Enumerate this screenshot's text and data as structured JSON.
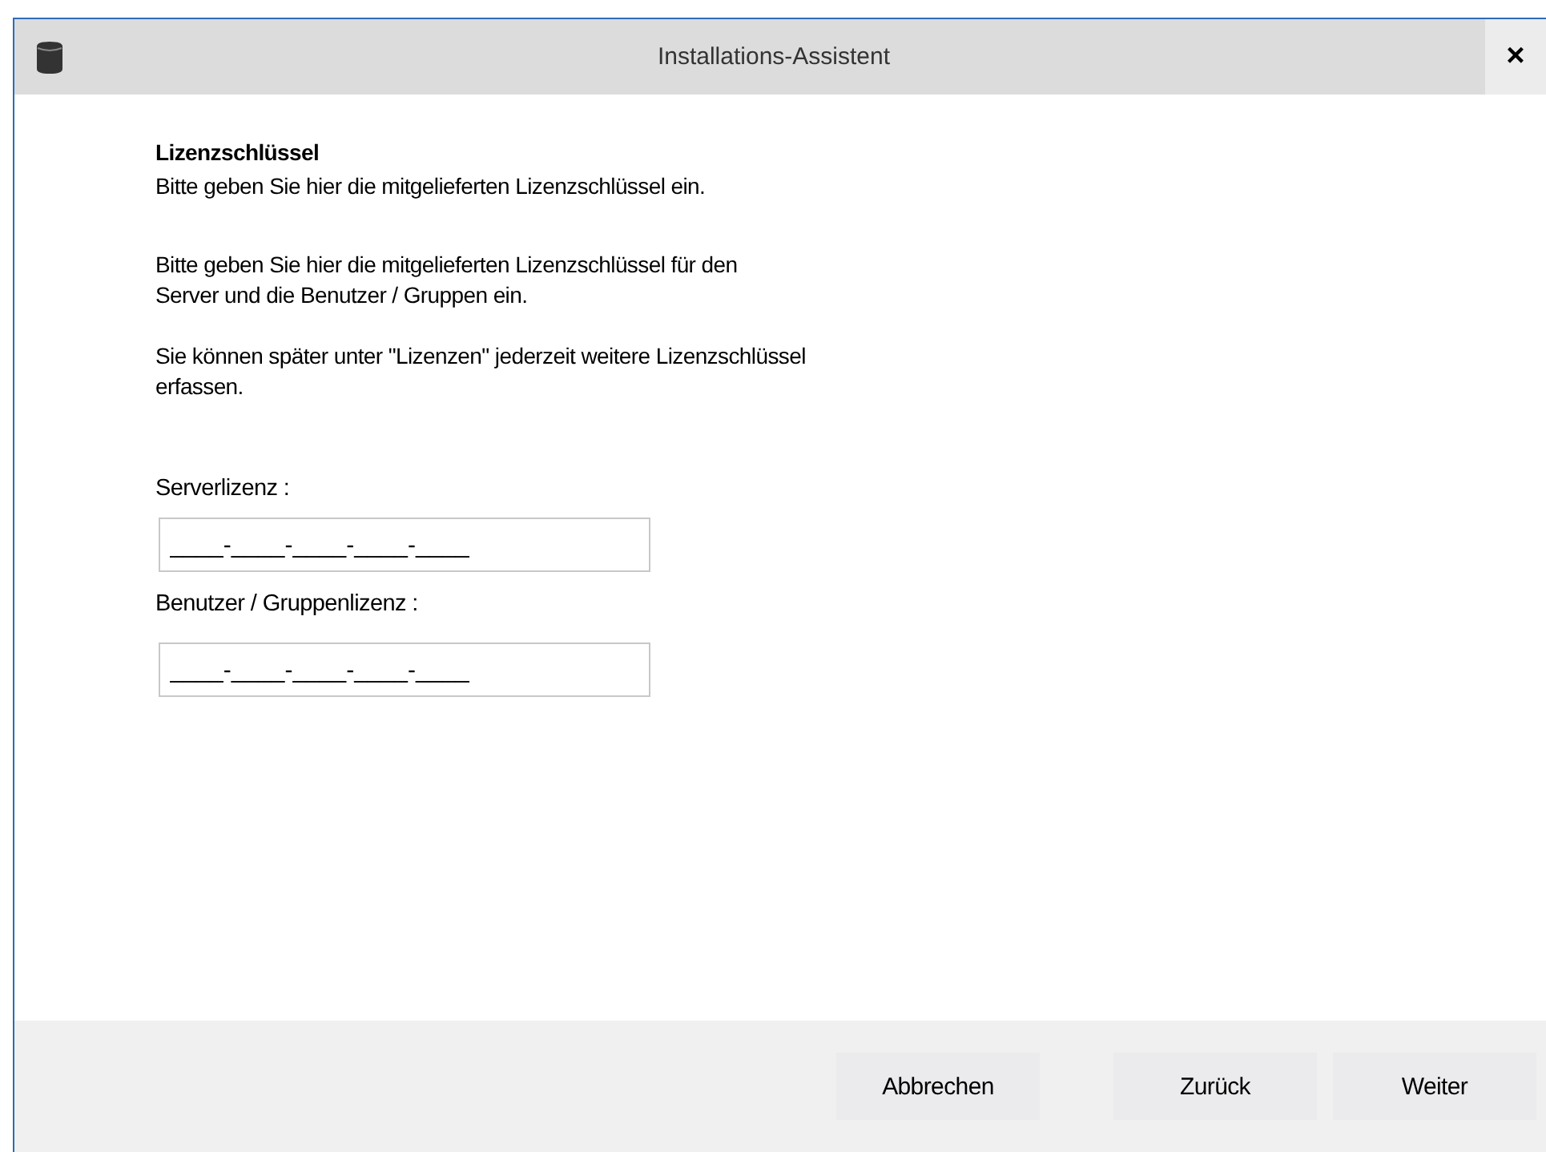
{
  "window": {
    "title": "Installations-Assistent",
    "close": "×"
  },
  "page": {
    "heading": "Lizenzschlüssel",
    "subtitle": "Bitte geben Sie hier die mitgelieferten Lizenzschlüssel ein.",
    "paragraphs": [
      "Bitte geben Sie hier die mitgelieferten Lizenzschlüssel für den\nServer und die Benutzer / Gruppen ein.",
      "Sie können später unter \"Lizenzen\" jederzeit weitere Lizenzschlüssel\nerfassen."
    ]
  },
  "fields": [
    {
      "label": "Serverlizenz :",
      "value": "____-____-____-____-____"
    },
    {
      "label": "Benutzer / Gruppenlizenz :",
      "value": "____-____-____-____-____"
    }
  ],
  "buttons": [
    "Abbrechen",
    "Zurück",
    "Weiter"
  ]
}
